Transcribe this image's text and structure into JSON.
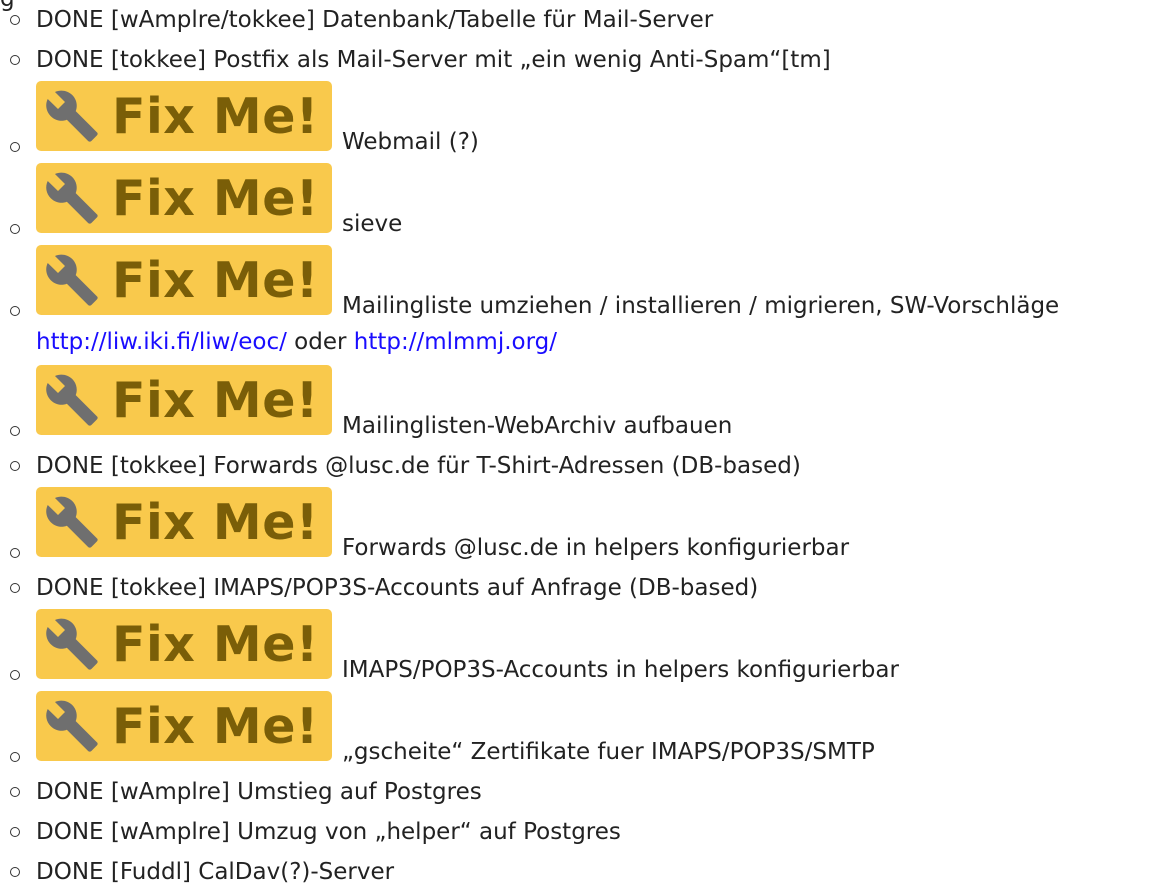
{
  "page": {
    "cut_top_text": "g"
  },
  "items": [
    {
      "type": "text",
      "text": "DONE [wAmplre/tokkee] Datenbank/Tabelle für Mail-Server"
    },
    {
      "type": "text",
      "text": "DONE [tokkee] Postfix als Mail-Server mit „ein wenig Anti-Spam“[tm]"
    },
    {
      "type": "fixme",
      "badge": "Fix Me!",
      "text": "Webmail (?)"
    },
    {
      "type": "fixme",
      "badge": "Fix Me!",
      "text": "sieve"
    },
    {
      "type": "fixme",
      "badge": "Fix Me!",
      "text": "Mailingliste umziehen / installieren / migrieren, SW-Vorschläge",
      "link1": "http://liw.iki.fi/liw/eoc/",
      "between": " oder ",
      "link2": "http://mlmmj.org/"
    },
    {
      "type": "fixme",
      "badge": "Fix Me!",
      "text": "Mailinglisten-WebArchiv aufbauen"
    },
    {
      "type": "text",
      "text": "DONE [tokkee] Forwards @lusc.de für T-Shirt-Adressen (DB-based)"
    },
    {
      "type": "fixme",
      "badge": "Fix Me!",
      "text": "Forwards @lusc.de in helpers konfigurierbar"
    },
    {
      "type": "text",
      "text": "DONE [tokkee] IMAPS/POP3S-Accounts auf Anfrage (DB-based)"
    },
    {
      "type": "fixme",
      "badge": "Fix Me!",
      "text": "IMAPS/POP3S-Accounts in helpers konfigurierbar"
    },
    {
      "type": "fixme",
      "badge": "Fix Me!",
      "text": "„gscheite“ Zertifikate fuer IMAPS/POP3S/SMTP"
    },
    {
      "type": "text",
      "text": "DONE [wAmplre] Umstieg auf Postgres"
    },
    {
      "type": "text",
      "text": "DONE [wAmplre] Umzug von „helper“ auf Postgres"
    },
    {
      "type": "text",
      "text": "DONE [Fuddl] CalDav(?)-Server"
    }
  ],
  "colors": {
    "badge_bg": "#f9c94c",
    "badge_text": "#7a5e08",
    "wrench": "#6f6f6f",
    "link": "#1a0dff"
  },
  "icons": {
    "badge_icon": "wrench-icon",
    "bullet": "hollow-circle-bullet"
  }
}
